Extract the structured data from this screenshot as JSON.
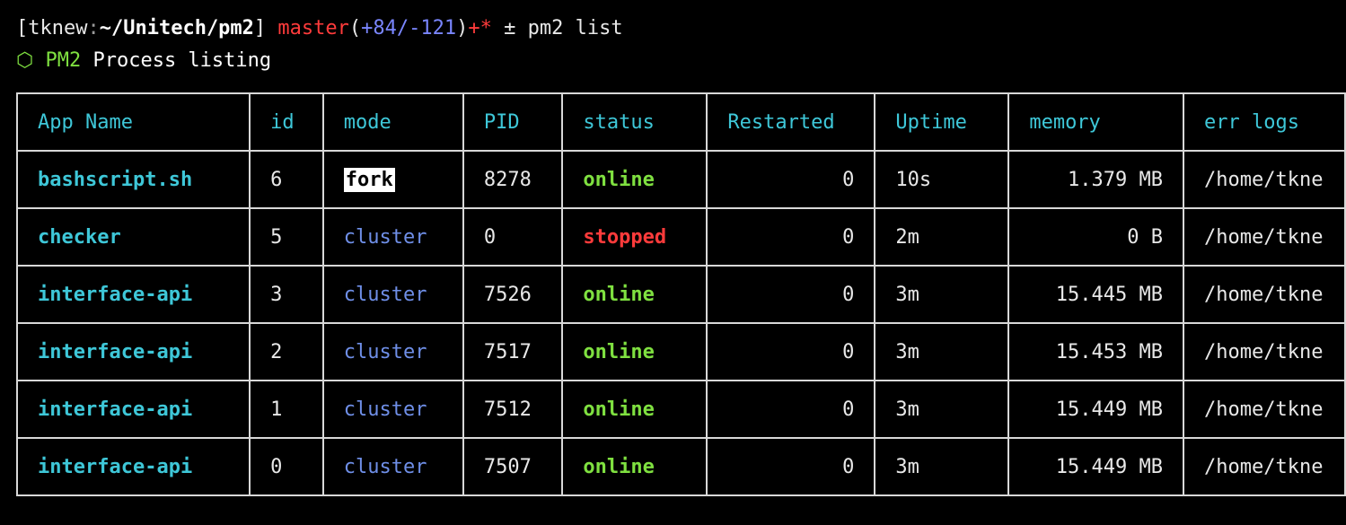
{
  "prompt": {
    "open_bracket": "[",
    "user": "tknew",
    "colon": ":",
    "path": "~/Unitech/pm2",
    "close_bracket": "]",
    "branch": "master",
    "open_paren": "(",
    "added": "+84",
    "separator": "/",
    "removed": "-121",
    "close_paren": ")",
    "flags": "+*",
    "command": "± pm2 list"
  },
  "pm2_header": {
    "logo": "⬡",
    "tag": "PM2",
    "title": "Process listing"
  },
  "table": {
    "headers": [
      "App Name",
      "id",
      "mode",
      "PID",
      "status",
      "Restarted",
      "Uptime",
      "memory",
      "err logs"
    ],
    "rows": [
      {
        "name": "bashscript.sh",
        "id": "6",
        "mode": "fork",
        "pid": "8278",
        "status": "online",
        "restarted": "0",
        "uptime": "10s",
        "memory": "1.379 MB",
        "err_logs": "/home/tkne"
      },
      {
        "name": "checker",
        "id": "5",
        "mode": "cluster",
        "pid": "0",
        "status": "stopped",
        "restarted": "0",
        "uptime": "2m",
        "memory": "0 B",
        "err_logs": "/home/tkne"
      },
      {
        "name": "interface-api",
        "id": "3",
        "mode": "cluster",
        "pid": "7526",
        "status": "online",
        "restarted": "0",
        "uptime": "3m",
        "memory": "15.445 MB",
        "err_logs": "/home/tkne"
      },
      {
        "name": "interface-api",
        "id": "2",
        "mode": "cluster",
        "pid": "7517",
        "status": "online",
        "restarted": "0",
        "uptime": "3m",
        "memory": "15.453 MB",
        "err_logs": "/home/tkne"
      },
      {
        "name": "interface-api",
        "id": "1",
        "mode": "cluster",
        "pid": "7512",
        "status": "online",
        "restarted": "0",
        "uptime": "3m",
        "memory": "15.449 MB",
        "err_logs": "/home/tkne"
      },
      {
        "name": "interface-api",
        "id": "0",
        "mode": "cluster",
        "pid": "7507",
        "status": "online",
        "restarted": "0",
        "uptime": "3m",
        "memory": "15.449 MB",
        "err_logs": "/home/tkne"
      }
    ]
  },
  "colors": {
    "background": "#000000",
    "header_cyan": "#3ec7d8",
    "online_green": "#7fe040",
    "stopped_red": "#ff3b3b",
    "cluster_blue": "#6f8fe8",
    "branch_red": "#ff3b3b",
    "diff_blue": "#7a86ff"
  }
}
